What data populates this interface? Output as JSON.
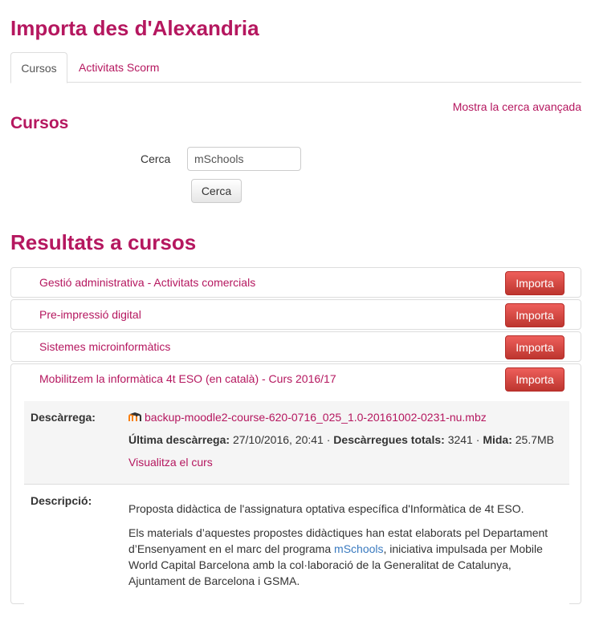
{
  "page": {
    "title": "Importa des d'Alexandria"
  },
  "tabs": [
    {
      "label": "Cursos",
      "active": true
    },
    {
      "label": "Activitats Scorm",
      "active": false
    }
  ],
  "advanced_link": "Mostra la cerca avançada",
  "search": {
    "heading": "Cursos",
    "label": "Cerca",
    "value": "mSchools",
    "button": "Cerca"
  },
  "results": {
    "heading": "Resultats a cursos",
    "courses": [
      {
        "name": "Gestió administrativa - Activitats comercials",
        "button": "Importa"
      },
      {
        "name": "Pre-impressió digital",
        "button": "Importa"
      },
      {
        "name": "Sistemes microinformàtics",
        "button": "Importa"
      },
      {
        "name": "Mobilitzem la informàtica 4t ESO (en català) - Curs 2016/17",
        "button": "Importa"
      }
    ],
    "expanded": {
      "download_label": "Descàrrega:",
      "file_name": "backup-moodle2-course-620-0716_025_1.0-20161002-0231-nu.mbz",
      "last_download_label": "Última descàrrega:",
      "last_download_value": "27/10/2016, 20:41",
      "sep1": "·",
      "total_downloads_label": "Descàrregues totals:",
      "total_downloads_value": "3241",
      "sep2": "·",
      "size_label": "Mida:",
      "size_value": "25.7MB",
      "view_course": "Visualitza el curs",
      "description_label": "Descripció:",
      "description_p1": "Proposta didàctica de l'assignatura optativa específica d'Informàtica de 4t ESO.",
      "description_p2_before": "Els materials d’aquestes propostes didàctiques han estat elaborats pel Departament d’Ensenyament en el marc del programa",
      "description_p2_link": "mSchools",
      "description_p2_after": ", iniciativa impulsada per Mobile World Capital Barcelona amb la col·laboració de la Generalitat de Catalunya, Ajuntament de Barcelona i GSMA."
    }
  },
  "colors": {
    "accent": "#b5175f",
    "danger": "#bd362f",
    "link_blue": "#3a7abf"
  },
  "icons": {
    "file": "moodle-icon"
  }
}
